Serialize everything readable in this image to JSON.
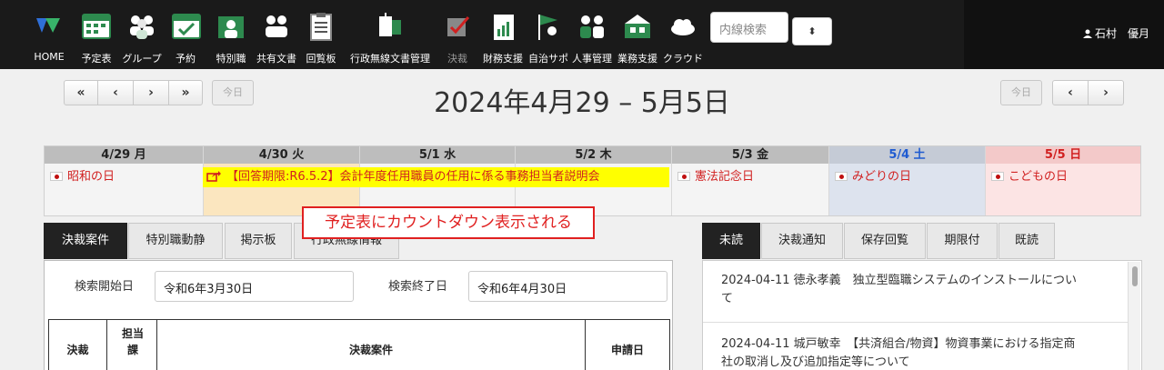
{
  "nav": {
    "items": [
      {
        "label": "HOME",
        "icon": "home-logo-icon"
      },
      {
        "label": "予定表",
        "icon": "calendar-icon"
      },
      {
        "label": "グループ",
        "icon": "group-icon"
      },
      {
        "label": "予約",
        "icon": "reservation-icon"
      },
      {
        "label": "特別職",
        "icon": "special-staff-icon"
      },
      {
        "label": "共有文書",
        "icon": "shared-docs-icon"
      },
      {
        "label": "回覧板",
        "icon": "clipboard-icon"
      },
      {
        "label": "行政無線文書管理",
        "icon": "radio-doc-icon"
      },
      {
        "label": "決裁",
        "icon": "approval-icon"
      },
      {
        "label": "財務支援",
        "icon": "finance-icon"
      },
      {
        "label": "自治サポ",
        "icon": "self-govern-icon"
      },
      {
        "label": "人事管理",
        "icon": "hr-icon"
      },
      {
        "label": "業務支援",
        "icon": "business-support-icon"
      },
      {
        "label": "クラウド",
        "icon": "cloud-icon"
      }
    ],
    "extension_search_placeholder": "内線検索",
    "user_name": "石村　優月"
  },
  "calendar": {
    "nav_buttons": [
      "«",
      "‹",
      "›",
      "»"
    ],
    "today_label": "今日",
    "title": "2024年4月29 – 5月5日",
    "days": [
      {
        "header": "4/29 月",
        "holiday": "昭和の日"
      },
      {
        "header": "4/30 火",
        "holiday": ""
      },
      {
        "header": "5/1 水",
        "holiday": ""
      },
      {
        "header": "5/2 木",
        "holiday": ""
      },
      {
        "header": "5/3 金",
        "holiday": "憲法記念日"
      },
      {
        "header": "5/4 土",
        "holiday": "みどりの日"
      },
      {
        "header": "5/5 日",
        "holiday": "こどもの日"
      }
    ],
    "event": "【回答期限:R6.5.2】会計年度任用職員の任用に係る事務担当者説明会",
    "callout": "予定表にカウントダウン表示される"
  },
  "left_tabs": [
    "決裁案件",
    "特別職動静",
    "掲示板",
    "行政無線情報"
  ],
  "right_tabs": [
    "未読",
    "決裁通知",
    "保存回覧",
    "期限付",
    "既読"
  ],
  "search": {
    "start_label": "検索開始日",
    "start_value": "令和6年3月30日",
    "end_label": "検索終了日",
    "end_value": "令和6年4月30日"
  },
  "table": {
    "headers": [
      "決裁",
      "担当課",
      "決裁案件",
      "申請日"
    ]
  },
  "notices": [
    {
      "line1": "2024-04-11 徳永孝義　独立型臨職システムのインストールについ",
      "line2": "て"
    },
    {
      "line1": "2024-04-11 城戸敏幸　【共済組合/物資】物資事業における指定商",
      "line2": "社の取消し及び追加指定等について"
    }
  ]
}
